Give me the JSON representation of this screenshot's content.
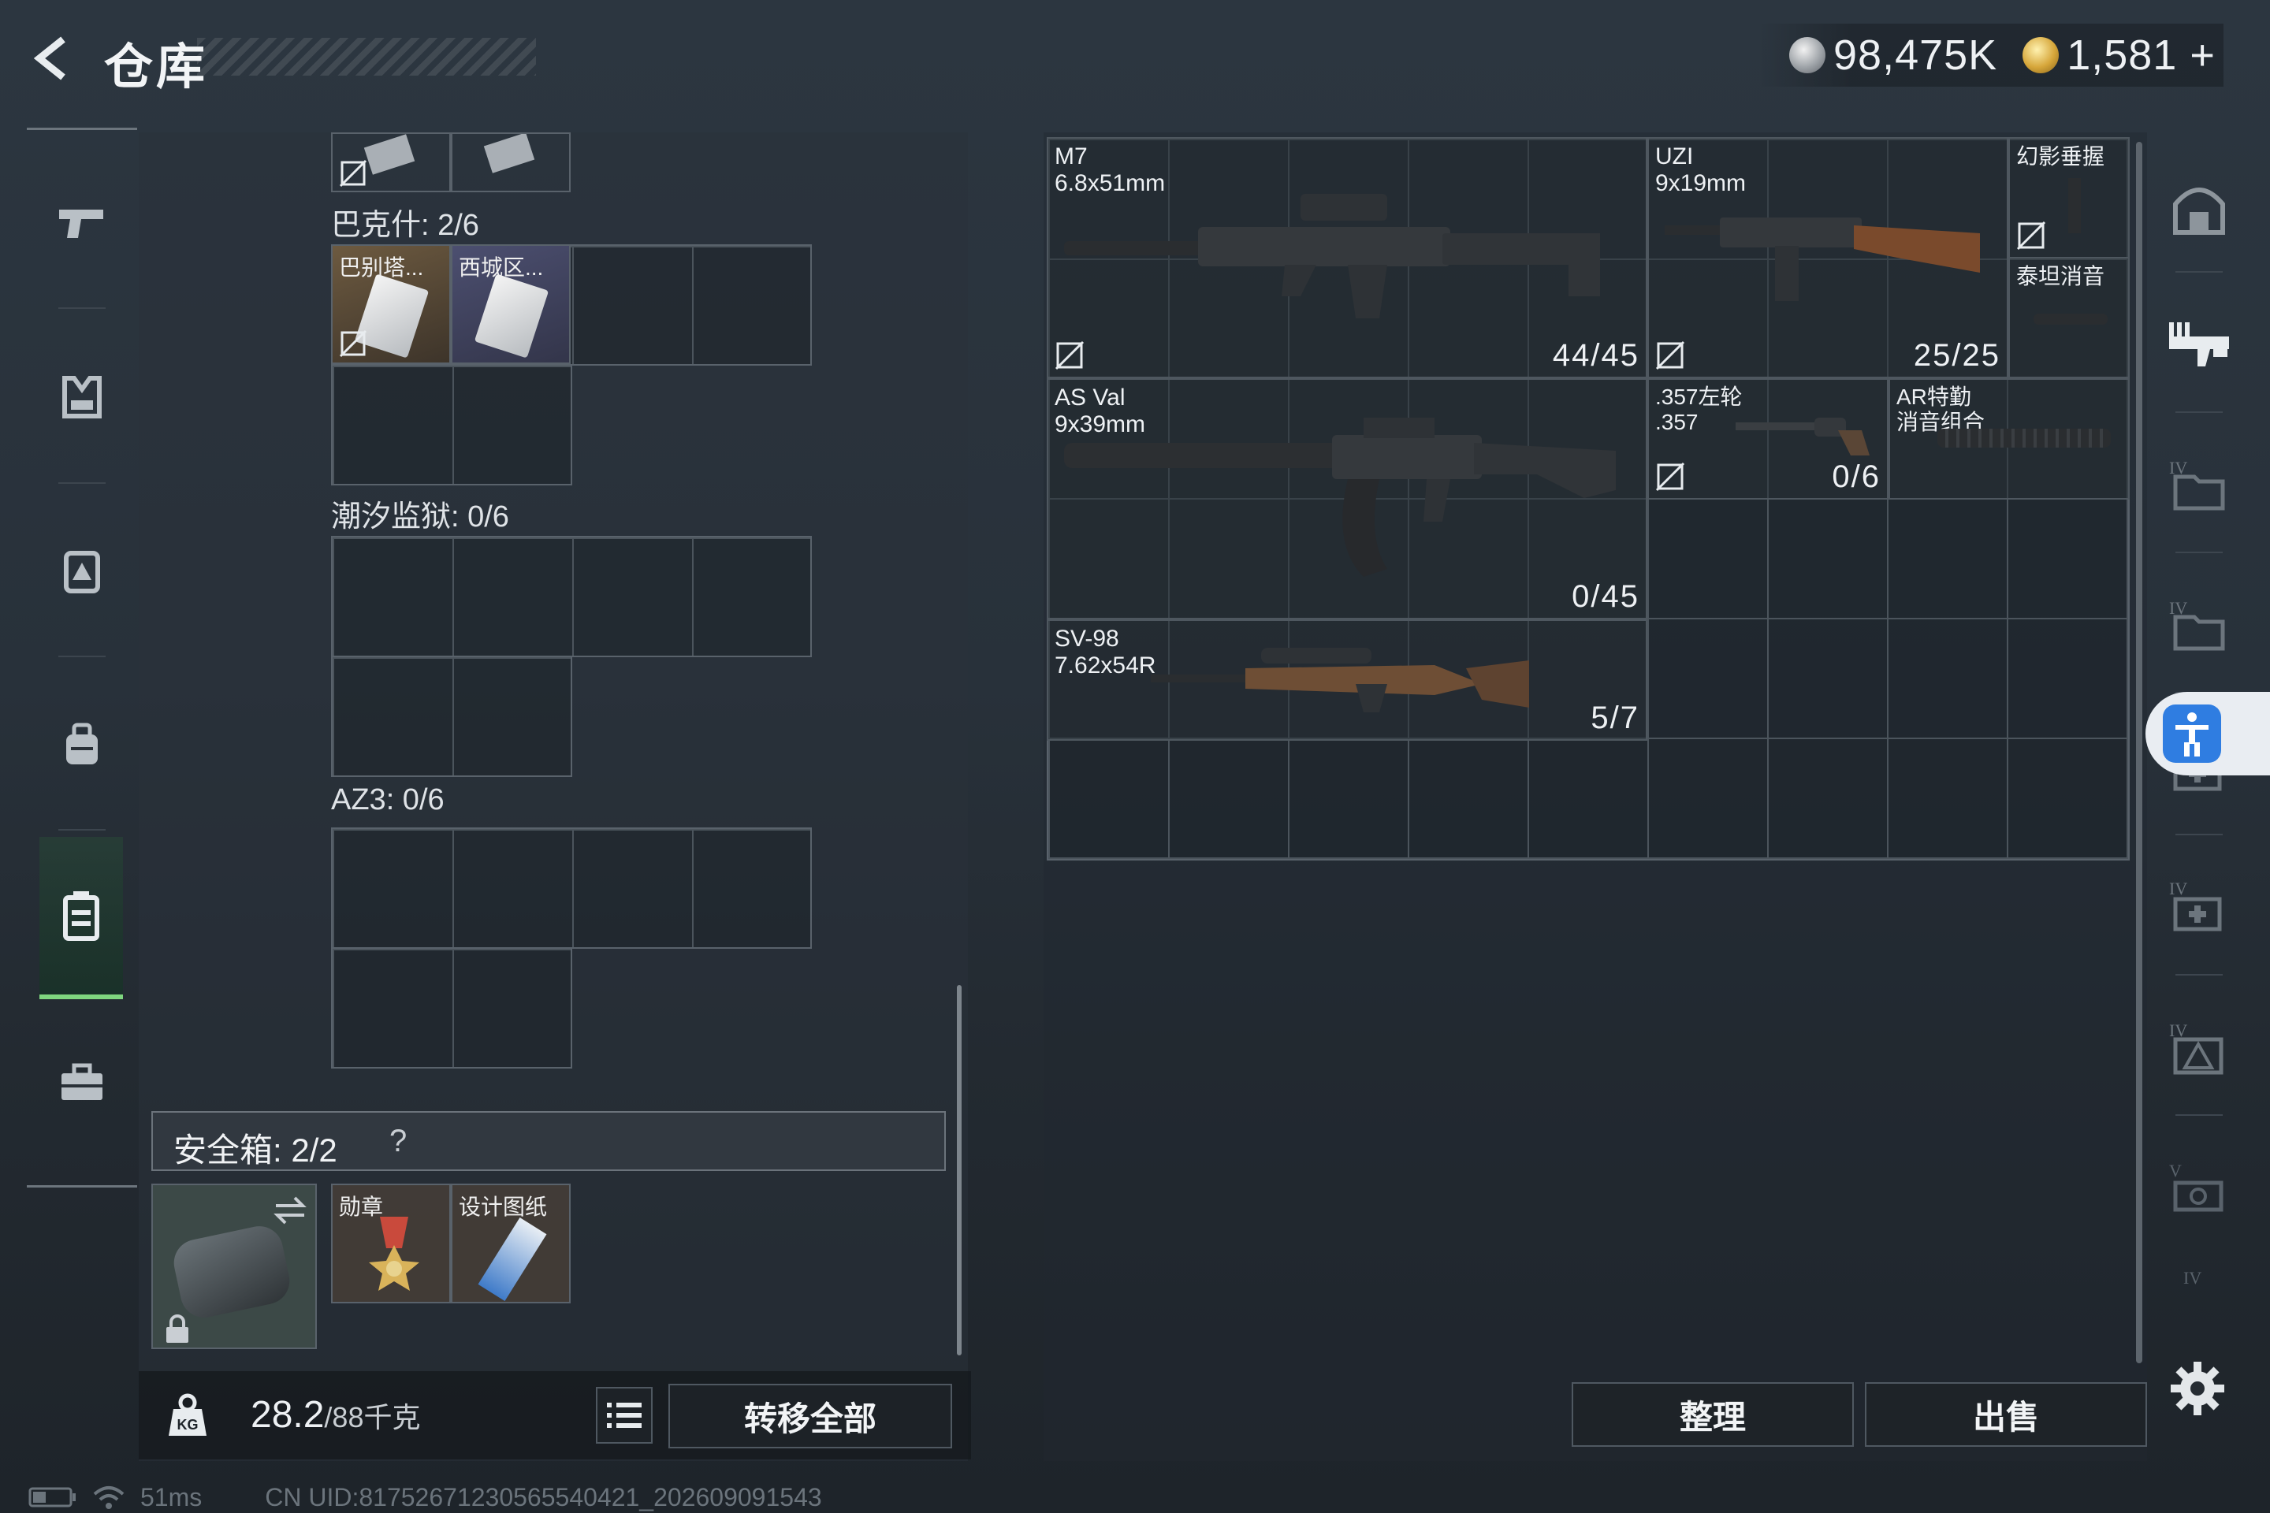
{
  "header": {
    "title": "仓库",
    "currency1": "98,475K",
    "currency2": "1,581",
    "add_symbol": "+"
  },
  "left_nav": {
    "items": [
      "pistol-icon",
      "armor-icon",
      "backpack-icon",
      "bag-icon",
      "inventory-icon",
      "briefcase-icon"
    ],
    "active_index": 4
  },
  "sections": {
    "bakshi": {
      "label": "巴克什: 2/6",
      "items": [
        {
          "name": "巴别塔..."
        },
        {
          "name": "西城区..."
        }
      ]
    },
    "tide_prison": {
      "label": "潮汐监狱: 0/6"
    },
    "az3": {
      "label": "AZ3: 0/6"
    }
  },
  "safebox": {
    "title": "安全箱:  2/2",
    "help": "?",
    "items": [
      {
        "name": "勋章"
      },
      {
        "name": "设计图纸"
      }
    ]
  },
  "bottom_left": {
    "weight": "28.2",
    "weight_cap": "/88千克",
    "kg_badge": "KG",
    "transfer_all": "转移全部"
  },
  "weapons": [
    {
      "name": "M7",
      "caliber": "6.8x51mm",
      "ammo": "44/45"
    },
    {
      "name": "UZI",
      "caliber": "9x19mm",
      "ammo": "25/25"
    },
    {
      "name": "AS Val",
      "caliber": "9x39mm",
      "ammo": "0/45"
    },
    {
      "name": ".357左轮",
      "caliber": ".357",
      "ammo": "0/6"
    },
    {
      "name": "SV-98",
      "caliber": "7.62x54R",
      "ammo": "5/7"
    }
  ],
  "attachments": [
    {
      "name": "幻影垂握"
    },
    {
      "name": "泰坦消音"
    },
    {
      "name": "AR特勤\n消音组合"
    }
  ],
  "buttons": {
    "sort": "整理",
    "sell": "出售"
  },
  "right_nav": {
    "items": [
      "shelter-icon",
      "armory-icon",
      "tier4-folder-icon",
      "tier4-folder-icon-2",
      "tier4-medkit-icon",
      "tier4-medkit-icon-2",
      "tier4-warning-icon",
      "tier5-tools-icon",
      "tier4-icon"
    ]
  },
  "status_bar": {
    "ping": "51ms",
    "uid": "CN UID:81752671230565540421_202609091543"
  },
  "colors": {
    "accent_green": "#7fd77f",
    "accessibility_blue": "#2f7de1"
  }
}
